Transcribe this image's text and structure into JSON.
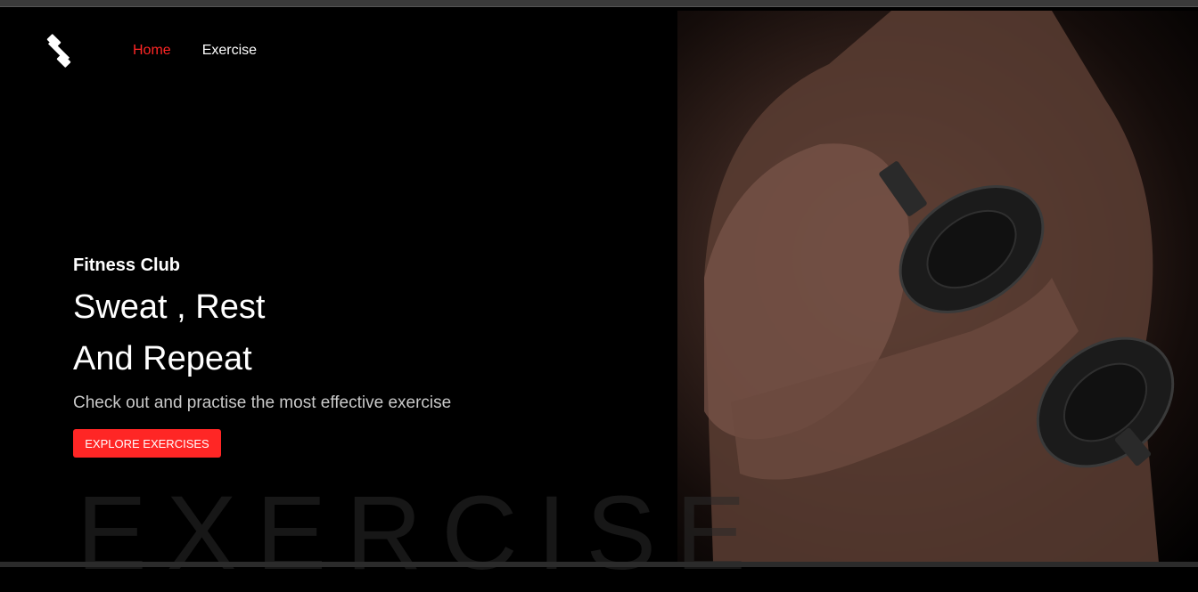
{
  "nav": {
    "items": [
      {
        "label": "Home",
        "active": true
      },
      {
        "label": "Exercise",
        "active": false
      }
    ]
  },
  "logo": {
    "icon": "dumbbell-icon"
  },
  "hero": {
    "kicker": "Fitness Club",
    "headline_line1": "Sweat , Rest",
    "headline_line2": "And Repeat",
    "subtitle": "Check out and practise the most effective exercise",
    "cta_label": "EXPLORE EXERCISES",
    "background_word": "EXERCISE",
    "image": "man-with-dumbbell-photo"
  },
  "colors": {
    "accent": "#ff2625",
    "background": "#000000"
  }
}
